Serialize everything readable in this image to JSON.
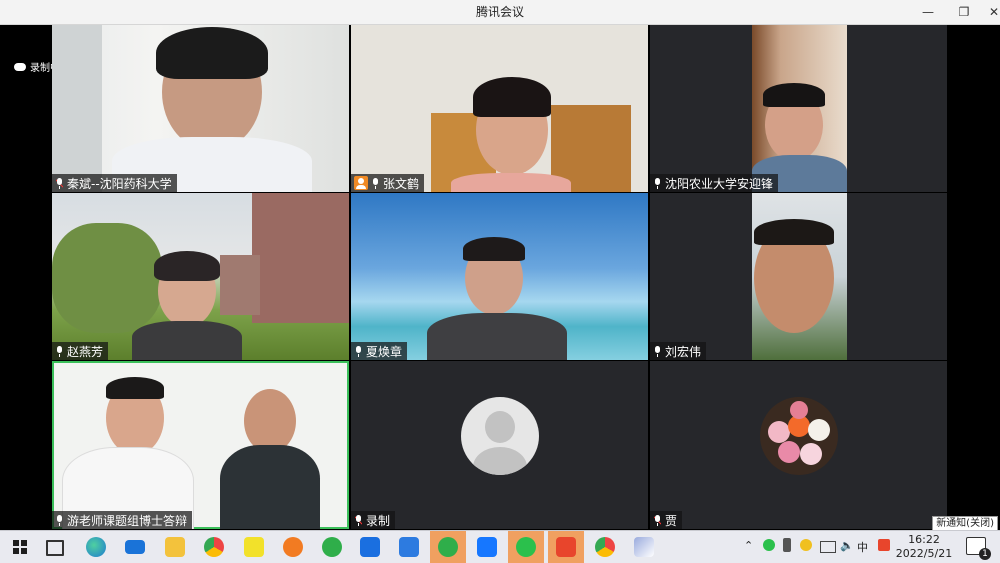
{
  "window": {
    "title": "腾讯会议",
    "controls": {
      "minimize": "—",
      "maximize": "❐",
      "close": "✕"
    }
  },
  "recording_label": "录制中",
  "participants": [
    {
      "name": "秦斌--沈阳药科大学",
      "mic": "muted"
    },
    {
      "name": "张文鹤",
      "mic": "on",
      "badge": "host"
    },
    {
      "name": "沈阳农业大学安迎锋",
      "mic": "on"
    },
    {
      "name": "赵燕芳",
      "mic": "on"
    },
    {
      "name": "夏焕章",
      "mic": "on"
    },
    {
      "name": "刘宏伟",
      "mic": "on"
    },
    {
      "name": "游老师课题组博士答辩",
      "mic": "on"
    },
    {
      "name": "录制",
      "mic": "muted"
    },
    {
      "name": "贾",
      "mic": "muted"
    }
  ],
  "taskbar": {
    "ime": "中",
    "clock_time": "16:22",
    "clock_date": "2022/5/21",
    "notification_count": "1",
    "notify_text": "新通知(关闭)",
    "icons": [
      "windows-start",
      "task-view",
      "edge",
      "mail",
      "file-explorer",
      "chrome",
      "player",
      "app-orange",
      "app-green",
      "app-blue",
      "app-bird",
      "app-green-circle",
      "tencent-meeting",
      "wechat",
      "app-red",
      "chrome-2",
      "paint"
    ]
  }
}
